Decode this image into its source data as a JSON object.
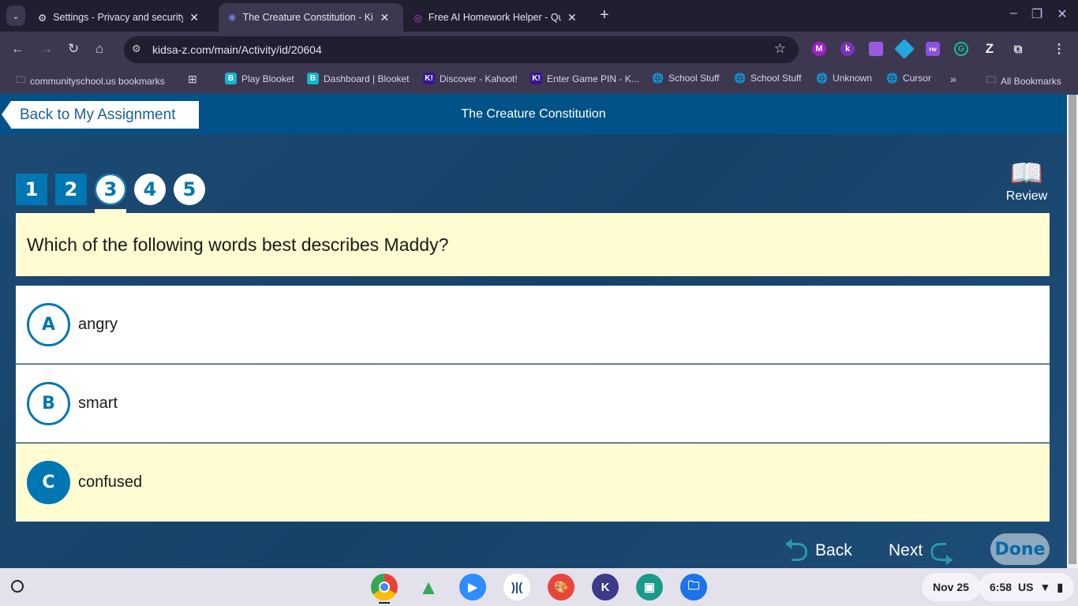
{
  "browser": {
    "tabs": [
      {
        "title": "Settings - Privacy and security",
        "icon": "gear-icon",
        "active": false
      },
      {
        "title": "The Creature Constitution - Kids A-Z",
        "icon": "kids-az-icon",
        "active": true
      },
      {
        "title": "Free AI Homework Helper - Question.AI",
        "icon": "target-icon",
        "active": false
      }
    ],
    "url": "kidsa-z.com/main/Activity/id/20604",
    "bookmarks": [
      {
        "label": "communityschool.us bookmarks",
        "icon": "managed-folder-icon"
      },
      {
        "label": "Play Blooket",
        "icon": "blooket-icon"
      },
      {
        "label": "Dashboard | Blooket",
        "icon": "blooket-icon"
      },
      {
        "label": "Discover - Kahoot!",
        "icon": "kahoot-icon"
      },
      {
        "label": "Enter Game PIN - K...",
        "icon": "kahoot-icon"
      },
      {
        "label": "School Stuff",
        "icon": "globe-icon"
      },
      {
        "label": "School Stuff",
        "icon": "globe-icon"
      },
      {
        "label": "Unknown",
        "icon": "globe-icon"
      },
      {
        "label": "Cursor",
        "icon": "globe-icon"
      }
    ],
    "all_bookmarks": "All Bookmarks"
  },
  "activity": {
    "back_label": "Back to My Assignment",
    "title": "The Creature Constitution",
    "questions": [
      "1",
      "2",
      "3",
      "4",
      "5"
    ],
    "current_question": 3,
    "review_label": "Review",
    "question": "Which of the following words best describes Maddy?",
    "options": [
      {
        "letter": "A",
        "text": "angry",
        "selected": false
      },
      {
        "letter": "B",
        "text": "smart",
        "selected": false
      },
      {
        "letter": "C",
        "text": "confused",
        "selected": true
      }
    ],
    "back": "Back",
    "next": "Next",
    "done": "Done"
  },
  "shelf": {
    "date": "Nov 25",
    "time": "6:58",
    "locale": "US"
  }
}
